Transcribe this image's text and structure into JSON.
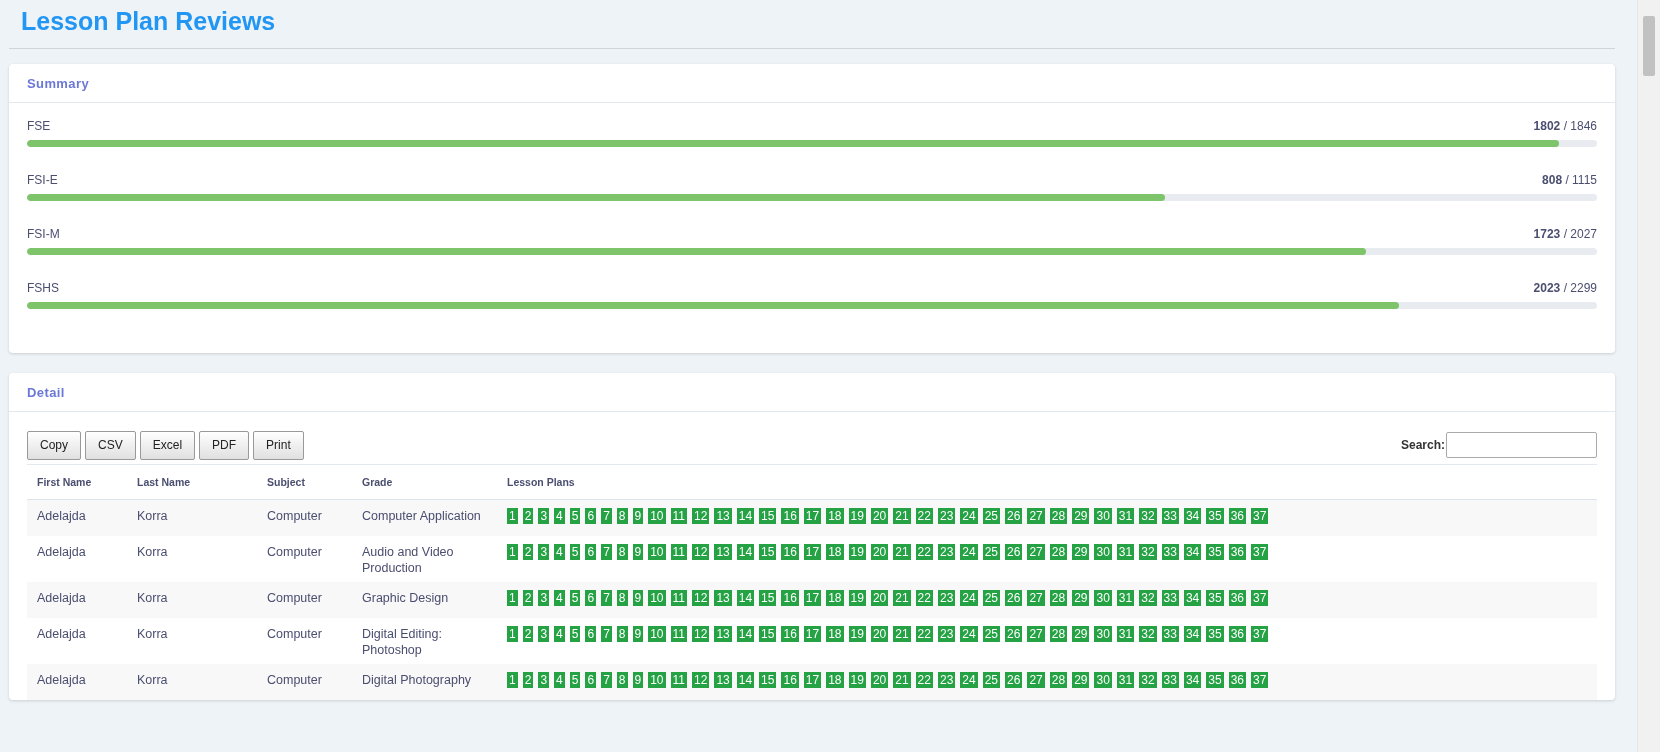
{
  "page_title": "Lesson Plan Reviews",
  "summary": {
    "title": "Summary",
    "items": [
      {
        "label": "FSE",
        "count": "**1802** / 1846",
        "level": 0.976
      },
      {
        "label": "FSI-E",
        "count": "**808** / 1115",
        "level": 0.725
      },
      {
        "label": "FSI-M",
        "count": "**1723** / 2027",
        "level": 0.853
      },
      {
        "label": "FSHS",
        "count": "**2023** / 2299",
        "level": 0.874
      }
    ]
  },
  "detail": {
    "title": "Detail",
    "buttons": [
      "Copy",
      "CSV",
      "Excel",
      "PDF",
      "Print"
    ],
    "search_label": "Search:",
    "table": {
      "columns": [
        "First Name",
        "Last Name",
        "Subject",
        "Grade",
        "Lesson Plans"
      ],
      "rows": [
        {
          "first_name": "Adelajda",
          "last_name": "Korra",
          "subject": "Computer",
          "grade": "Computer Application",
          "lesson_plans": [
            "1",
            "2",
            "3",
            "4",
            "5",
            "6",
            "7",
            "8",
            "9",
            "10",
            "11",
            "12",
            "13",
            "14",
            "15",
            "16",
            "17",
            "18",
            "19",
            "20",
            "21",
            "22",
            "23",
            "24",
            "25",
            "26",
            "27",
            "28",
            "29",
            "30",
            "31",
            "32",
            "33",
            "34",
            "35",
            "36",
            "37"
          ]
        },
        {
          "first_name": "Adelajda",
          "last_name": "Korra",
          "subject": "Computer",
          "grade": "Audio and Video Production",
          "lesson_plans": [
            "1",
            "2",
            "3",
            "4",
            "5",
            "6",
            "7",
            "8",
            "9",
            "10",
            "11",
            "12",
            "13",
            "14",
            "15",
            "16",
            "17",
            "18",
            "19",
            "20",
            "21",
            "22",
            "23",
            "24",
            "25",
            "26",
            "27",
            "28",
            "29",
            "30",
            "31",
            "32",
            "33",
            "34",
            "35",
            "36",
            "37"
          ]
        },
        {
          "first_name": "Adelajda",
          "last_name": "Korra",
          "subject": "Computer",
          "grade": "Graphic Design",
          "lesson_plans": [
            "1",
            "2",
            "3",
            "4",
            "5",
            "6",
            "7",
            "8",
            "9",
            "10",
            "11",
            "12",
            "13",
            "14",
            "15",
            "16",
            "17",
            "18",
            "19",
            "20",
            "21",
            "22",
            "23",
            "24",
            "25",
            "26",
            "27",
            "28",
            "29",
            "30",
            "31",
            "32",
            "33",
            "34",
            "35",
            "36",
            "37"
          ]
        },
        {
          "first_name": "Adelajda",
          "last_name": "Korra",
          "subject": "Computer",
          "grade": "Digital Editing: Photoshop",
          "lesson_plans": [
            "1",
            "2",
            "3",
            "4",
            "5",
            "6",
            "7",
            "8",
            "9",
            "10",
            "11",
            "12",
            "13",
            "14",
            "15",
            "16",
            "17",
            "18",
            "19",
            "20",
            "21",
            "22",
            "23",
            "24",
            "25",
            "26",
            "27",
            "28",
            "29",
            "30",
            "31",
            "32",
            "33",
            "34",
            "35",
            "36",
            "37"
          ]
        },
        {
          "first_name": "Adelajda",
          "last_name": "Korra",
          "subject": "Computer",
          "grade": "Digital Photography",
          "lesson_plans": [
            "1",
            "2",
            "3",
            "4",
            "5",
            "6",
            "7",
            "8",
            "9",
            "10",
            "11",
            "12",
            "13",
            "14",
            "15",
            "16",
            "17",
            "18",
            "19",
            "20",
            "21",
            "22",
            "23",
            "24",
            "25",
            "26",
            "27",
            "28",
            "29",
            "30",
            "31",
            "32",
            "33",
            "34",
            "35",
            "36",
            "37"
          ]
        }
      ]
    }
  }
}
